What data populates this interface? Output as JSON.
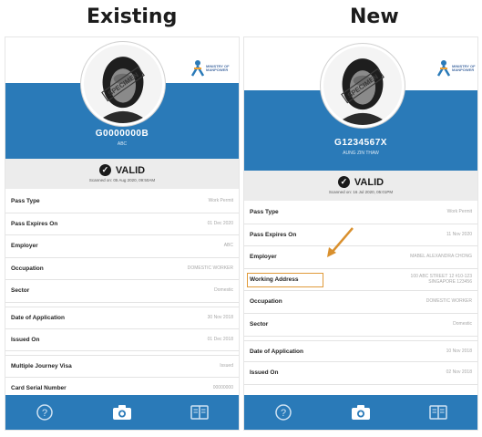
{
  "columns": {
    "left_title": "Existing",
    "right_title": "New"
  },
  "existing": {
    "pass_id": "G0000000B",
    "holder_name": "ABC",
    "status": "VALID",
    "scanned": "Scanned on: 05 Aug 2020, 09:50AM",
    "rows": [
      {
        "label": "Pass Type",
        "value": "Work Permit"
      },
      {
        "label": "Pass Expires On",
        "value": "01 Dec 2020"
      },
      {
        "label": "Employer",
        "value": "ABC"
      },
      {
        "label": "Occupation",
        "value": "DOMESTIC WORKER"
      },
      {
        "label": "Sector",
        "value": "Domestic"
      },
      {
        "label": "Date of Application",
        "value": "30 Nov 2018"
      },
      {
        "label": "Issued On",
        "value": "01 Dec 2018"
      },
      {
        "label": "Multiple Journey Visa",
        "value": "Issued"
      },
      {
        "label": "Card Serial Number",
        "value": "00000000"
      }
    ]
  },
  "new": {
    "pass_id": "G1234567X",
    "holder_name": "AUNG ZIN THAW",
    "status": "VALID",
    "scanned": "Scanned on: 16 Jul 2020, 05:01PM",
    "rows": [
      {
        "label": "Pass Type",
        "value": "Work Permit"
      },
      {
        "label": "Pass Expires On",
        "value": "11 Nov 2020"
      },
      {
        "label": "Employer",
        "value": "MABEL ALEXANDRA CHONG"
      },
      {
        "label": "Working Address",
        "value": "100 ABC STREET 12 #10-123 SINGAPORE 123456"
      },
      {
        "label": "Occupation",
        "value": "DOMESTIC WORKER"
      },
      {
        "label": "Sector",
        "value": "Domestic"
      },
      {
        "label": "Date of Application",
        "value": "10 Nov 2018"
      },
      {
        "label": "Issued On",
        "value": "02 Nov 2018"
      }
    ]
  },
  "logo_text": "MINISTRY OF MANPOWER",
  "stamp_text": "SPECIMEN",
  "icons": [
    "help-icon",
    "camera-icon",
    "book-icon",
    "check-circle-icon",
    "arrow-icon"
  ],
  "colors": {
    "banner": "#2a7ab8",
    "highlight": "#e09a3a",
    "arrow": "#d9902e"
  }
}
